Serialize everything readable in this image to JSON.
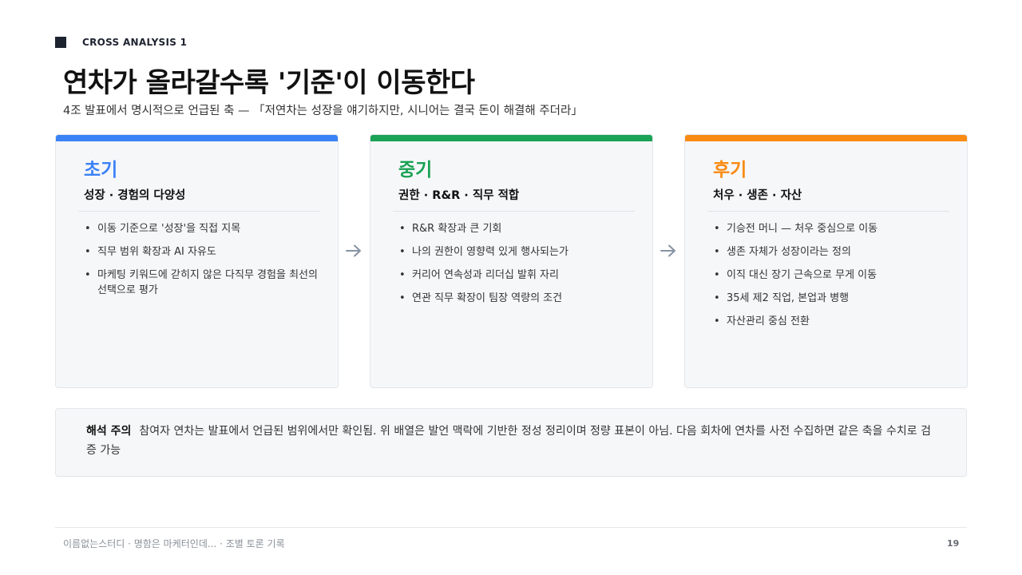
{
  "header": {
    "eyebrow": "CROSS ANALYSIS 1",
    "title": "연차가 올라갈수록 '기준'이 이동한다",
    "subtitle": "4조 발표에서 명시적으로 언급된 축 — 「저연차는 성장을 얘기하지만, 시니어는 결국 돈이 해결해 주더라」"
  },
  "colors": {
    "early": "#3b82f6",
    "mid": "#1aa255",
    "late": "#f98b12",
    "arrow": "#8793a3"
  },
  "cards": [
    {
      "phase": "초기",
      "heading": "성장 · 경험의 다양성",
      "items": [
        "이동 기준으로 '성장'을 직접 지목",
        "직무 범위 확장과 AI 자유도",
        "마케팅 키워드에 갇히지 않은 다직무 경험을 최선의 선택으로 평가"
      ]
    },
    {
      "phase": "중기",
      "heading": "권한 · R&R · 직무 적합",
      "items": [
        "R&R 확장과 큰 기회",
        "나의 권한이 영향력 있게 행사되는가",
        "커리어 연속성과 리더십 발휘 자리",
        "연관 직무 확장이 팀장 역량의 조건"
      ]
    },
    {
      "phase": "후기",
      "heading": "처우 · 생존 · 자산",
      "items": [
        "기승전 머니 — 처우 중심으로 이동",
        "생존 자체가 성장이라는 정의",
        "이직 대신 장기 근속으로 무게 이동",
        "35세 제2 직업, 본업과 병행",
        "자산관리 중심 전환"
      ]
    }
  ],
  "note": {
    "label": "해석 주의",
    "text": "참여자 연차는 발표에서 언급된 범위에서만 확인됨. 위 배열은 발언 맥락에 기반한 정성 정리이며 정량 표본이 아님. 다음 회차에 연차를 사전 수집하면 같은 축을 수치로 검증 가능"
  },
  "footer": {
    "text": "이름없는스터디 · 명함은 마케터인데... · 조별 토론 기록",
    "page": "19"
  }
}
